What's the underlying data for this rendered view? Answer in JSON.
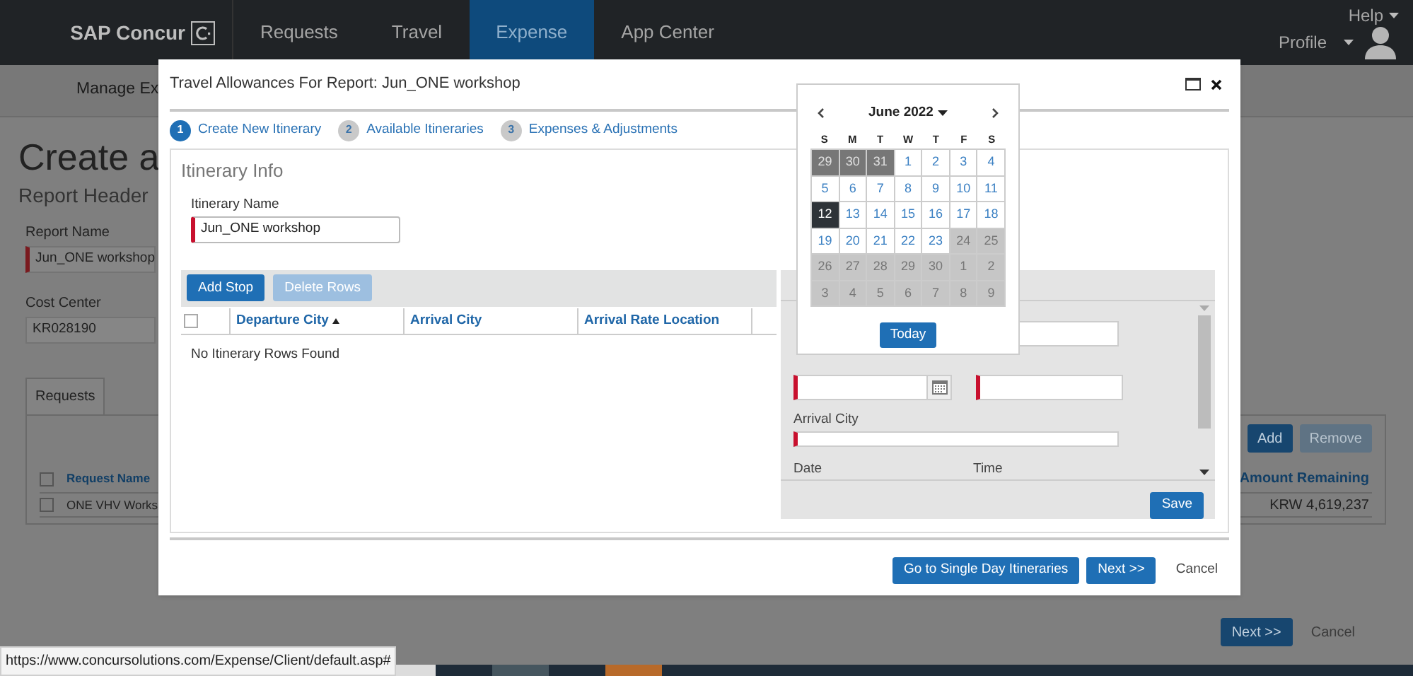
{
  "nav": {
    "logo": "SAP Concur",
    "items": [
      {
        "label": "Requests",
        "selected": false
      },
      {
        "label": "Travel",
        "selected": false
      },
      {
        "label": "Expense",
        "selected": true
      },
      {
        "label": "App Center",
        "selected": false
      }
    ],
    "help": "Help",
    "profile": "Profile"
  },
  "page": {
    "subnav": "Manage Ex",
    "title": "Create a",
    "subtitle": "Report Header",
    "fields": [
      {
        "label": "Report Name",
        "value": "Jun_ONE workshop",
        "required": true
      },
      {
        "label": "Cost Center",
        "value": "KR028190",
        "required": false
      }
    ],
    "tab": "Requests",
    "buttons": [
      {
        "label": "Add",
        "disabled": false
      },
      {
        "label": "Remove",
        "disabled": true
      }
    ],
    "columns": [
      "Request Name",
      "Amount Remaining"
    ],
    "all_checked": false,
    "rows": [
      {
        "name": "ONE VHV Works",
        "amount": "KRW 4,619,237",
        "checked": false
      }
    ],
    "next": "Next >>",
    "cancel": "Cancel"
  },
  "modal": {
    "title": "Travel Allowances For Report: Jun_ONE workshop",
    "steps": [
      {
        "number": "1",
        "label": "Create New Itinerary",
        "selected": true
      },
      {
        "number": "2",
        "label": "Available Itineraries",
        "selected": false
      },
      {
        "number": "3",
        "label": "Expenses & Adjustments",
        "selected": false
      }
    ],
    "section": "Itinerary Info",
    "name_label": "Itinerary Name",
    "name_value": "Jun_ONE workshop",
    "toolbar": [
      {
        "label": "Add Stop",
        "disabled": false
      },
      {
        "label": "Delete Rows",
        "disabled": true
      }
    ],
    "all_checked": false,
    "columns": [
      {
        "label": "Departure City",
        "sorted": true
      },
      {
        "label": "Arrival City",
        "sorted": false
      },
      {
        "label": "Arrival Rate Location",
        "sorted": false
      }
    ],
    "empty": "No Itinerary Rows Found",
    "panel": {
      "arrival_label": "Arrival City",
      "date_label": "Date",
      "time_label": "Time",
      "save": "Save"
    },
    "footer": [
      {
        "label": "Go to Single Day Itineraries",
        "kind": "button"
      },
      {
        "label": "Next >>",
        "kind": "button"
      },
      {
        "label": "Cancel",
        "kind": "link"
      }
    ]
  },
  "calendar": {
    "month": "June 2022",
    "weekdays": [
      "S",
      "M",
      "T",
      "W",
      "T",
      "F",
      "S"
    ],
    "today": "Today",
    "days": [
      {
        "label": "29",
        "kind": "prev",
        "selected": false
      },
      {
        "label": "30",
        "kind": "prev",
        "selected": false
      },
      {
        "label": "31",
        "kind": "prev",
        "selected": false
      },
      {
        "label": "1",
        "kind": "day",
        "selected": false
      },
      {
        "label": "2",
        "kind": "day",
        "selected": false
      },
      {
        "label": "3",
        "kind": "day",
        "selected": false
      },
      {
        "label": "4",
        "kind": "day",
        "selected": false
      },
      {
        "label": "5",
        "kind": "day",
        "selected": false
      },
      {
        "label": "6",
        "kind": "day",
        "selected": false
      },
      {
        "label": "7",
        "kind": "day",
        "selected": false
      },
      {
        "label": "8",
        "kind": "day",
        "selected": false
      },
      {
        "label": "9",
        "kind": "day",
        "selected": false
      },
      {
        "label": "10",
        "kind": "day",
        "selected": false
      },
      {
        "label": "11",
        "kind": "day",
        "selected": false
      },
      {
        "label": "12",
        "kind": "day",
        "selected": true
      },
      {
        "label": "13",
        "kind": "day",
        "selected": false
      },
      {
        "label": "14",
        "kind": "day",
        "selected": false
      },
      {
        "label": "15",
        "kind": "day",
        "selected": false
      },
      {
        "label": "16",
        "kind": "day",
        "selected": false
      },
      {
        "label": "17",
        "kind": "day",
        "selected": false
      },
      {
        "label": "18",
        "kind": "day",
        "selected": false
      },
      {
        "label": "19",
        "kind": "day",
        "selected": false
      },
      {
        "label": "20",
        "kind": "day",
        "selected": false
      },
      {
        "label": "21",
        "kind": "day",
        "selected": false
      },
      {
        "label": "22",
        "kind": "day",
        "selected": false
      },
      {
        "label": "23",
        "kind": "day",
        "selected": false
      },
      {
        "label": "24",
        "kind": "disabled",
        "selected": false
      },
      {
        "label": "25",
        "kind": "disabled",
        "selected": false
      },
      {
        "label": "26",
        "kind": "disabled",
        "selected": false
      },
      {
        "label": "27",
        "kind": "disabled",
        "selected": false
      },
      {
        "label": "28",
        "kind": "disabled",
        "selected": false
      },
      {
        "label": "29",
        "kind": "disabled",
        "selected": false
      },
      {
        "label": "30",
        "kind": "disabled",
        "selected": false
      },
      {
        "label": "1",
        "kind": "disabled",
        "selected": false
      },
      {
        "label": "2",
        "kind": "disabled",
        "selected": false
      },
      {
        "label": "3",
        "kind": "disabled",
        "selected": false
      },
      {
        "label": "4",
        "kind": "disabled",
        "selected": false
      },
      {
        "label": "5",
        "kind": "disabled",
        "selected": false
      },
      {
        "label": "6",
        "kind": "disabled",
        "selected": false
      },
      {
        "label": "7",
        "kind": "disabled",
        "selected": false
      },
      {
        "label": "8",
        "kind": "disabled",
        "selected": false
      },
      {
        "label": "9",
        "kind": "disabled",
        "selected": false
      }
    ]
  },
  "status_url": "https://www.concursolutions.com/Expense/Client/default.asp#"
}
